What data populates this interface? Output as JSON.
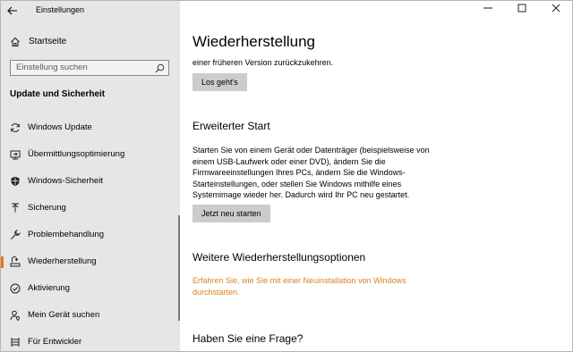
{
  "window": {
    "app_title": "Einstellungen",
    "controls": {
      "minimize": "—",
      "maximize": "☐",
      "close": "✕"
    }
  },
  "sidebar": {
    "home_label": "Startseite",
    "search_placeholder": "Einstellung suchen",
    "section_title": "Update und Sicherheit",
    "items": [
      {
        "label": "Windows Update",
        "icon": "sync-icon",
        "active": false
      },
      {
        "label": "Übermittlungsoptimierung",
        "icon": "delivery-icon",
        "active": false
      },
      {
        "label": "Windows-Sicherheit",
        "icon": "shield-icon",
        "active": false
      },
      {
        "label": "Sicherung",
        "icon": "backup-icon",
        "active": false
      },
      {
        "label": "Problembehandlung",
        "icon": "wrench-icon",
        "active": false
      },
      {
        "label": "Wiederherstellung",
        "icon": "recovery-icon",
        "active": true
      },
      {
        "label": "Aktivierung",
        "icon": "check-circle-icon",
        "active": false
      },
      {
        "label": "Mein Gerät suchen",
        "icon": "person-location-icon",
        "active": false
      },
      {
        "label": "Für Entwickler",
        "icon": "developer-icon",
        "active": false
      }
    ]
  },
  "main": {
    "page_title": "Wiederherstellung",
    "reset_text_partial": "einer früheren Version zurückzukehren.",
    "reset_button": "Los geht's",
    "advanced_title": "Erweiterter Start",
    "advanced_text": "Starten Sie von einem Gerät oder Datenträger (beispielsweise von einem USB-Laufwerk oder einer DVD), ändern Sie die Firmwareeinstellungen Ihres PCs, ändern Sie die Windows-Starteinstellungen, oder stellen Sie Windows mithilfe eines Systemimage wieder her. Dadurch wird Ihr PC neu gestartet.",
    "advanced_button": "Jetzt neu starten",
    "more_title": "Weitere Wiederherstellungsoptionen",
    "more_link": "Erfahren Sie, wie Sie mit einer Neuinstallation von Windows durchstarten.",
    "question_title": "Haben Sie eine Frage?"
  },
  "colors": {
    "accent": "#e07a12",
    "link": "#d9831f",
    "sidebar_bg": "#e6e6e6",
    "button_bg": "#cccccc"
  }
}
